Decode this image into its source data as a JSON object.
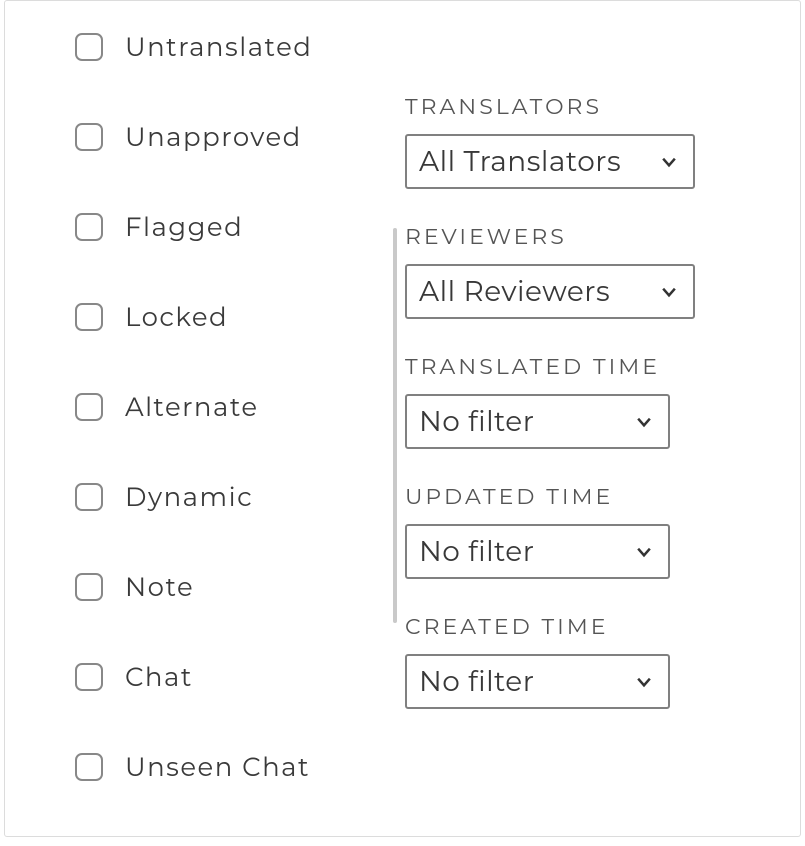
{
  "filters": {
    "checkboxes": [
      {
        "key": "untranslated",
        "label": "Untranslated"
      },
      {
        "key": "unapproved",
        "label": "Unapproved"
      },
      {
        "key": "flagged",
        "label": "Flagged"
      },
      {
        "key": "locked",
        "label": "Locked"
      },
      {
        "key": "alternate",
        "label": "Alternate"
      },
      {
        "key": "dynamic",
        "label": "Dynamic"
      },
      {
        "key": "note",
        "label": "Note"
      },
      {
        "key": "chat",
        "label": "Chat"
      },
      {
        "key": "unseen-chat",
        "label": "Unseen Chat"
      }
    ],
    "translators": {
      "label": "TRANSLATORS",
      "value": "All Translators"
    },
    "reviewers": {
      "label": "REVIEWERS",
      "value": "All Reviewers"
    },
    "translated_time": {
      "label": "TRANSLATED TIME",
      "value": "No filter"
    },
    "updated_time": {
      "label": "UPDATED TIME",
      "value": "No filter"
    },
    "created_time": {
      "label": "CREATED TIME",
      "value": "No filter"
    }
  }
}
